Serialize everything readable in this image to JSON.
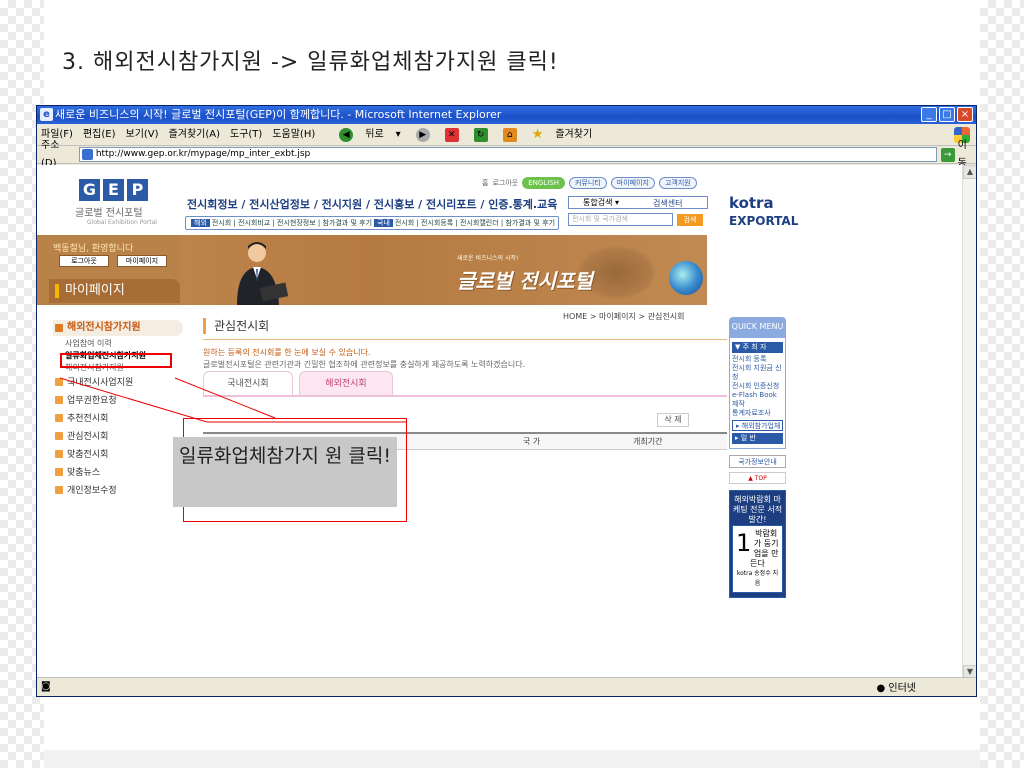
{
  "slide": {
    "title": "3. 해외전시참가지원 -> 일류화업체참가지원 클릭!"
  },
  "window": {
    "title": "새로운 비즈니스의 시작! 글로벌 전시포털(GEP)이 함께합니다. - Microsoft Internet Explorer",
    "menu": [
      "파일(F)",
      "편집(E)",
      "보기(V)",
      "즐겨찾기(A)",
      "도구(T)",
      "도움말(H)"
    ],
    "toolbar": {
      "back": "뒤로",
      "favorites": "즐겨찾기"
    },
    "address_label": "주소(D)",
    "url": "http://www.gep.or.kr/mypage/mp_inter_exbt.jsp",
    "go_label": "이동",
    "status_zone": "인터넷"
  },
  "site": {
    "logo": [
      "G",
      "E",
      "P"
    ],
    "logo_sub": "글로벌 전시포털",
    "logo_sub2": "Global Exhibition Portal",
    "top_links": {
      "home": "홈",
      "login": "로그아웃",
      "english": "ENGLISH",
      "community": "커뮤니티",
      "mypage": "마이페이지",
      "support": "고객지원"
    },
    "nav": "전시회정보 / 전시산업정보 / 전시지원 / 전시홍보 / 전시리포트 / 인증.통계.교육",
    "subnav_tag1": "해외",
    "subnav_a": "전시회 | 전시회비교 | 전시현장정보 | 참가결과 및 후기",
    "subnav_tag2": "국내",
    "subnav_b": "전시회 | 전시회등록 | 전시회캘린더 | 참가결과 및 후기",
    "search": {
      "select": "통합검색",
      "placeholder": "전시회 및 국가검색",
      "button": "검색",
      "center": "검색센터"
    },
    "kotra": "kotra",
    "export": "EXPORTAL",
    "welcome": "백동철님, 환영합니다",
    "logout_btn": "로그아웃",
    "mypage_btn": "마이페이지",
    "mypage_title": "마이페이지",
    "portal_small": "새로운 비즈니스의 시작!",
    "portal_title": "글로벌 전시포털"
  },
  "left_menu": {
    "header": "해외전시참가지원",
    "subs": [
      "사업참여 이력",
      "일류화업체전시참가지원",
      "해외전시참가지원"
    ],
    "items": [
      "국내전시사업지원",
      "업무권한요청",
      "추천전시회",
      "관심전시회",
      "맞춤전시회",
      "맞춤뉴스",
      "개인정보수정"
    ]
  },
  "main": {
    "breadcrumb": "HOME > 마이페이지 > 관심전시회",
    "title": "관심전시회",
    "desc1": "원하는 등록의 전시회를 한 눈에 보실 수 있습니다.",
    "desc2": "글로벌전시포털은 관련기관과 긴밀한 협조하에 관련정보를 충실하게 제공하도록 노력하겠습니다.",
    "tabs": [
      "국내전시회",
      "해외전시회"
    ],
    "delete_btn": "삭 제",
    "columns": [
      "국 가",
      "개최기간"
    ]
  },
  "quick": {
    "title": "QUICK MENU",
    "section1": "주 최 자",
    "items": [
      "전시회 등록",
      "전시회 지원금 신청",
      "전시회 인증신청",
      "e-Flash Book 제작",
      "통계자료조사"
    ],
    "section2": "해외참가업체",
    "section3": "일 반",
    "country": "국가정보안내",
    "top": "▲ TOP",
    "ad1": "해외박람회 마케팅 전문 서적 발간!",
    "ad2_big": "1",
    "ad2": "박람회가 둥기업을 만든다",
    "ad2_sub": "kotra 송정수 지음"
  },
  "callout": {
    "text": "일류화업체참가지 원 클릭!"
  }
}
